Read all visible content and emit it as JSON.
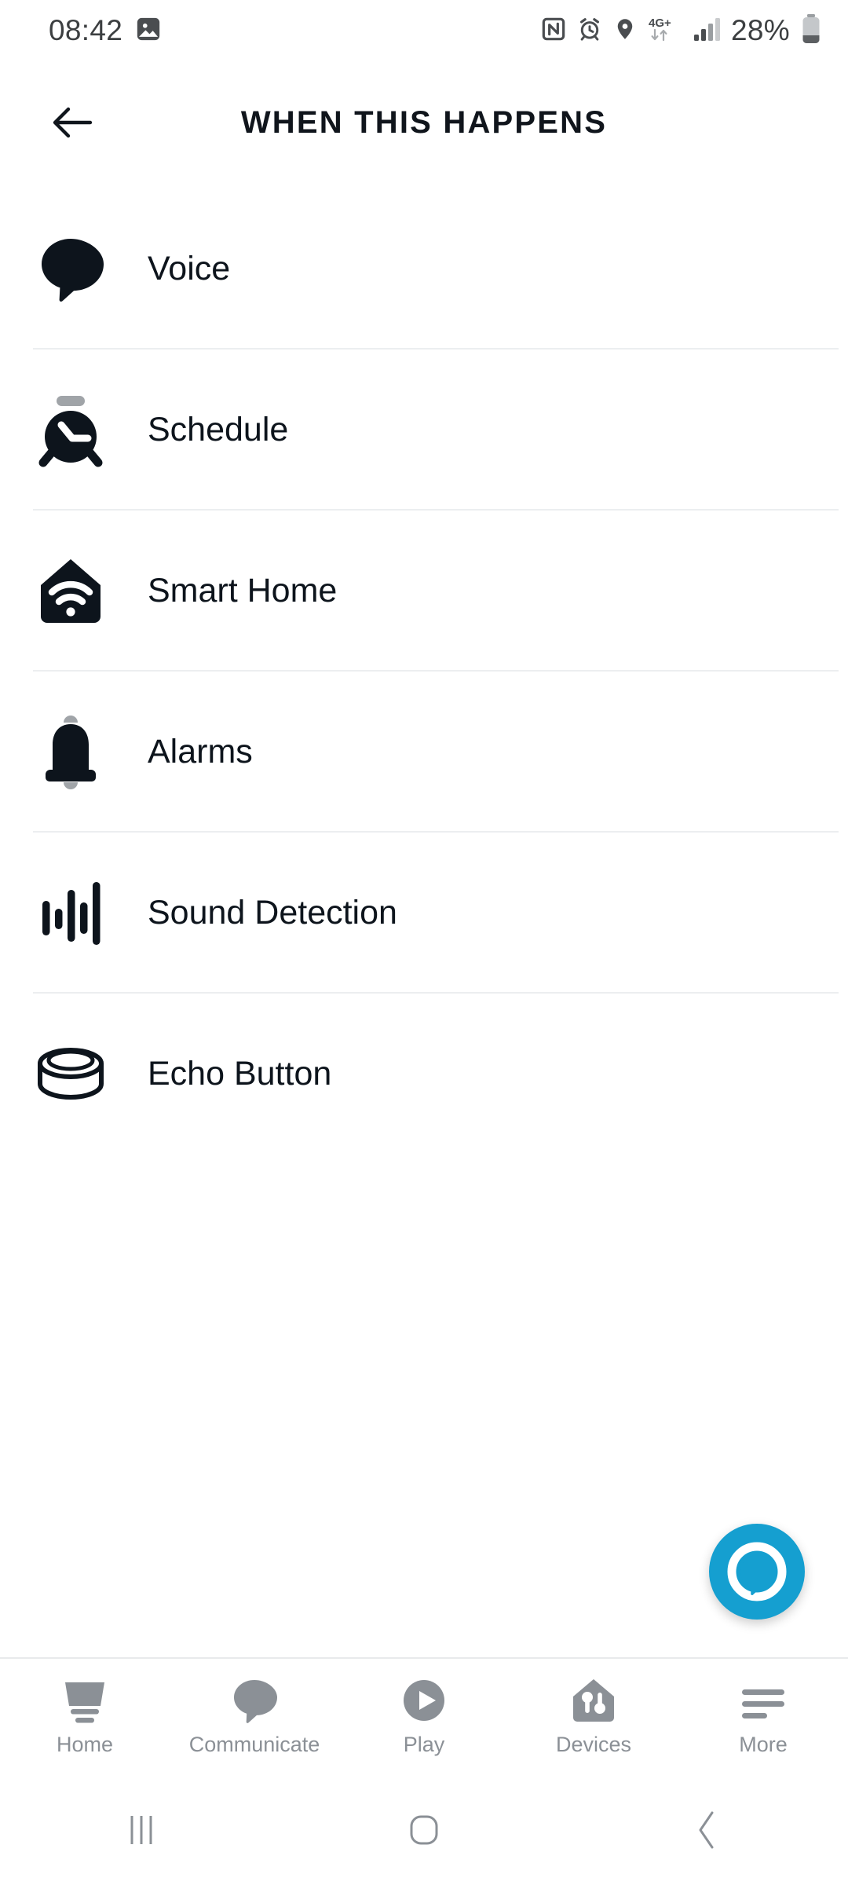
{
  "status_bar": {
    "time": "08:42",
    "left_icons": [
      {
        "name": "gallery-image-icon"
      }
    ],
    "right_icons": [
      {
        "name": "nfc-icon"
      },
      {
        "name": "alarm-clock-icon"
      },
      {
        "name": "location-pin-icon"
      },
      {
        "name": "network-4gplus-icon",
        "label": "4G+"
      },
      {
        "name": "signal-bars-icon"
      }
    ],
    "battery_percent": "28%",
    "battery_icon": "battery-icon"
  },
  "header": {
    "back_icon": "back-arrow-icon",
    "title": "WHEN THIS HAPPENS"
  },
  "list": {
    "items": [
      {
        "label": "Voice",
        "icon": "speech-bubble-icon"
      },
      {
        "label": "Schedule",
        "icon": "alarm-clock-icon"
      },
      {
        "label": "Smart Home",
        "icon": "house-wifi-icon"
      },
      {
        "label": "Alarms",
        "icon": "bell-icon"
      },
      {
        "label": "Sound Detection",
        "icon": "sound-waveform-icon"
      },
      {
        "label": "Echo Button",
        "icon": "echo-button-puck-icon"
      }
    ]
  },
  "fab": {
    "name": "alexa-assistant-button",
    "color": "#159fd0"
  },
  "bottom_nav": {
    "items": [
      {
        "label": "Home",
        "icon": "home-icon"
      },
      {
        "label": "Communicate",
        "icon": "speech-bubble-icon"
      },
      {
        "label": "Play",
        "icon": "play-circle-icon"
      },
      {
        "label": "Devices",
        "icon": "house-sliders-icon"
      },
      {
        "label": "More",
        "icon": "menu-lines-icon"
      }
    ],
    "color": "#8b9096"
  },
  "system_nav": {
    "recents": "recents-icon",
    "home": "home-square-icon",
    "back": "back-chevron-icon"
  },
  "colors": {
    "icon_dark": "#0d141c",
    "icon_grey": "#a0a4a8",
    "divider": "#eceef0",
    "accent": "#159fd0"
  }
}
